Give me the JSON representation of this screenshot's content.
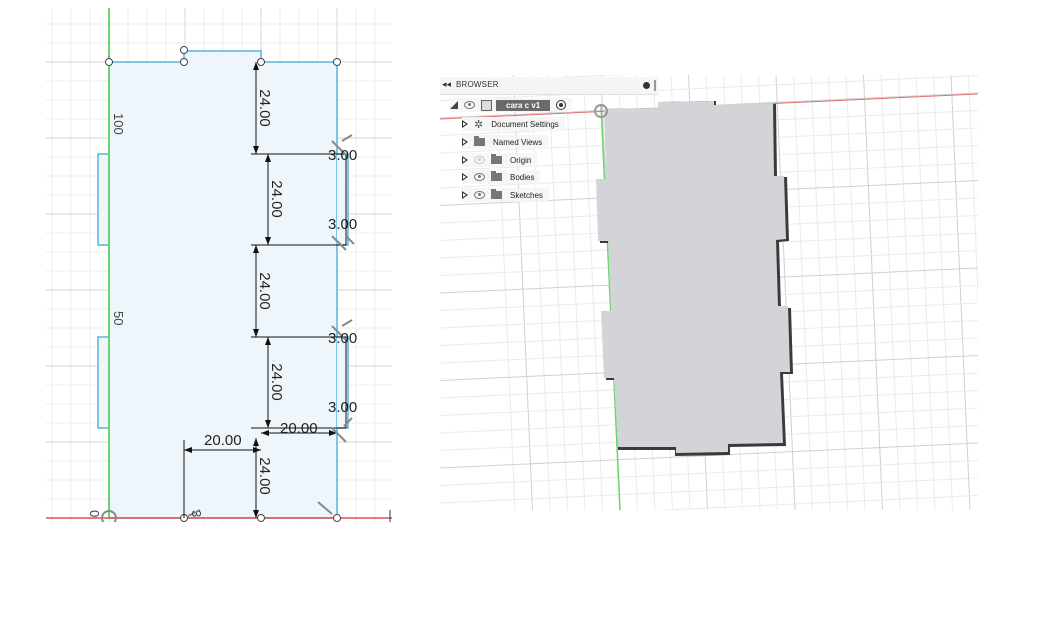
{
  "sketch": {
    "dimensions": {
      "d1": "24.00",
      "d2": "24.00",
      "d3": "24.00",
      "d4": "24.00",
      "d5": "24.00",
      "t1": "3.00",
      "t2": "3.00",
      "t3": "3.00",
      "t4": "3.00",
      "w1": "20.00",
      "w2": "20.00",
      "label_100": "100",
      "label_50": "50",
      "label_0": "0",
      "label_3": "3"
    }
  },
  "browser": {
    "title": "BROWSER",
    "component": "cara c v1",
    "items": [
      {
        "label": "Document Settings"
      },
      {
        "label": "Named Views"
      },
      {
        "label": "Origin"
      },
      {
        "label": "Bodies"
      },
      {
        "label": "Sketches"
      }
    ]
  },
  "colors": {
    "sketch_fill": "#eef6fc",
    "sketch_line": "#5ab4dc",
    "axis_green": "#6cd46c",
    "axis_red": "#e05050",
    "body_fill": "#d2d4d8",
    "body_edge": "#3a3a3a"
  }
}
